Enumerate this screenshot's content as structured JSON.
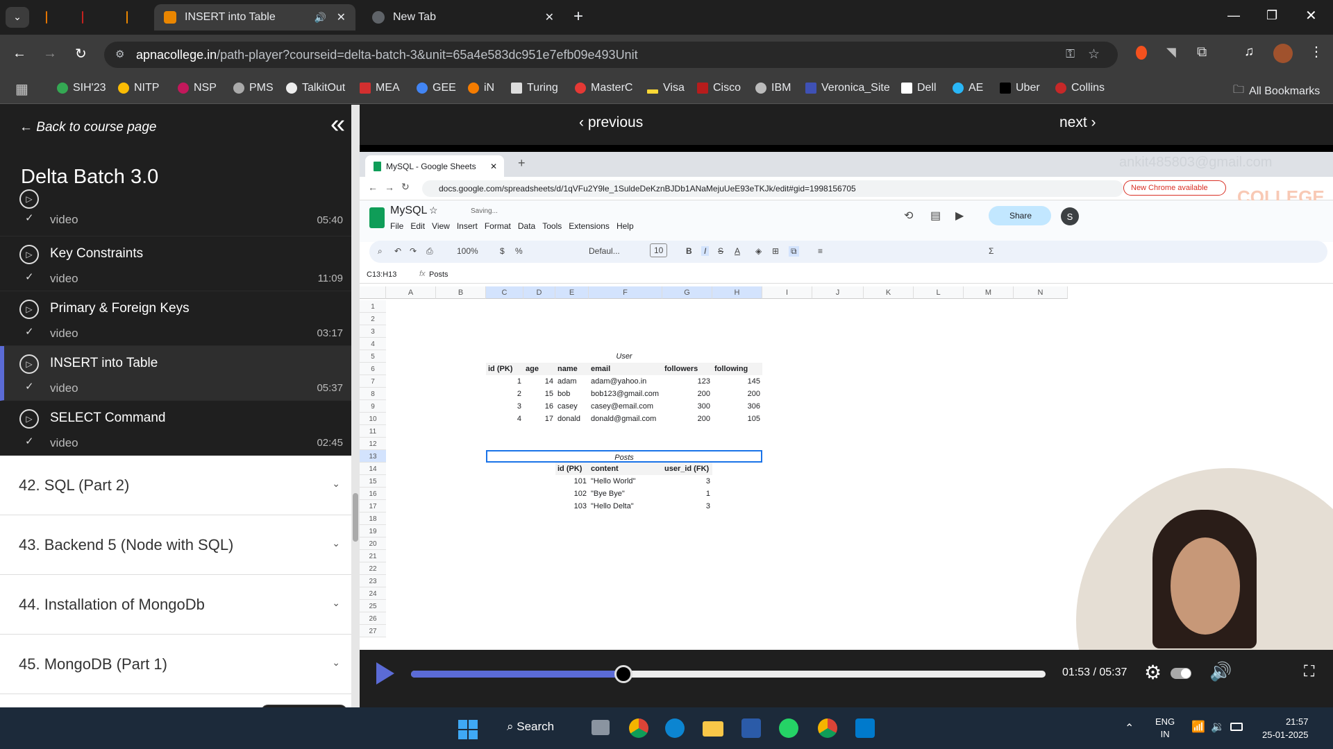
{
  "browser": {
    "tabs": [
      {
        "label": "",
        "color": "#e37400"
      },
      {
        "label": "",
        "color": "#c5221f"
      },
      {
        "label": "",
        "color": "#ea8600"
      },
      {
        "label": "INSERT into Table",
        "color": "#ea8600"
      },
      {
        "label": "New Tab",
        "color": "#5f6368"
      }
    ],
    "url_domain": "apnacollege.in",
    "url_path": "/path-player?courseid=delta-batch-3&unit=65a4e583dc951e7efb09e493Unit",
    "bookmarks": [
      "SIH'23",
      "NITP",
      "NSP",
      "PMS",
      "TalkitOut",
      "MEA",
      "GEE",
      "iN",
      "Turing",
      "MasterC",
      "Visa",
      "Cisco",
      "IBM",
      "Veronica_Site",
      "Dell",
      "AE",
      "Uber",
      "Collins"
    ],
    "all_bookmarks": "All Bookmarks"
  },
  "sidebar": {
    "back_label": "Back to course page",
    "course_title": "Delta Batch 3.0",
    "lessons": [
      {
        "title": "",
        "sub": "video",
        "time": "05:40"
      },
      {
        "title": "Key Constraints",
        "sub": "video",
        "time": "11:09"
      },
      {
        "title": "Primary & Foreign Keys",
        "sub": "video",
        "time": "03:17"
      },
      {
        "title": "INSERT into Table",
        "sub": "video",
        "time": "05:37"
      },
      {
        "title": "SELECT Command",
        "sub": "video",
        "time": "02:45"
      }
    ],
    "sections": [
      "42. SQL (Part 2)",
      "43. Backend 5 (Node with SQL)",
      "44. Installation of MongoDb",
      "45. MongoDB (Part 1)"
    ]
  },
  "video_nav": {
    "previous": "previous",
    "next": "next"
  },
  "screen": {
    "tab_title": "MySQL - Google Sheets",
    "url": "docs.google.com/spreadsheets/d/1qVFu2Y9le_1SuldeDeKznBJDb1ANaMejuUeE93eTKJk/edit#gid=1998156705",
    "new_chrome": "New Chrome available",
    "watermark_email": "ankit485803@gmail.com",
    "watermark_brand": "COLLEGE",
    "doc_title": "MySQL",
    "saving": "Saving...",
    "menus": [
      "File",
      "Edit",
      "View",
      "Insert",
      "Format",
      "Data",
      "Tools",
      "Extensions",
      "Help"
    ],
    "share": "Share",
    "avatar": "S",
    "zoom": "100%",
    "font": "Defaul...",
    "font_size": "10",
    "name_box": "C13:H13",
    "formula": "Posts",
    "columns": [
      "A",
      "B",
      "C",
      "D",
      "E",
      "F",
      "G",
      "H",
      "I",
      "J",
      "K",
      "L",
      "M",
      "N"
    ],
    "selected_cols": [
      "C",
      "D",
      "E",
      "F",
      "G",
      "H"
    ],
    "rows": [
      "1",
      "2",
      "3",
      "4",
      "5",
      "6",
      "7",
      "8",
      "9",
      "10",
      "11",
      "12",
      "13",
      "14",
      "15",
      "16",
      "17",
      "18",
      "19",
      "20",
      "21",
      "22",
      "23",
      "24",
      "25",
      "26",
      "27"
    ],
    "user_table": {
      "title": "User",
      "headers": [
        "id (PK)",
        "age",
        "name",
        "email",
        "followers",
        "following"
      ],
      "rows": [
        [
          "1",
          "14",
          "adam",
          "adam@yahoo.in",
          "123",
          "145"
        ],
        [
          "2",
          "15",
          "bob",
          "bob123@gmail.com",
          "200",
          "200"
        ],
        [
          "3",
          "16",
          "casey",
          "casey@email.com",
          "300",
          "306"
        ],
        [
          "4",
          "17",
          "donald",
          "donald@gmail.com",
          "200",
          "105"
        ]
      ]
    },
    "posts_table": {
      "title": "Posts",
      "headers": [
        "id (PK)",
        "content",
        "user_id (FK)"
      ],
      "rows": [
        [
          "101",
          "\"Hello World\"",
          "3"
        ],
        [
          "102",
          "\"Bye Bye\"",
          "1"
        ],
        [
          "103",
          "\"Hello Delta\"",
          "3"
        ]
      ]
    }
  },
  "player": {
    "time": "01:53 / 05:37",
    "progress": 0.335
  },
  "taskbar": {
    "search": "Search",
    "lang1": "ENG",
    "lang2": "IN",
    "time": "21:57",
    "date": "25-01-2025"
  }
}
